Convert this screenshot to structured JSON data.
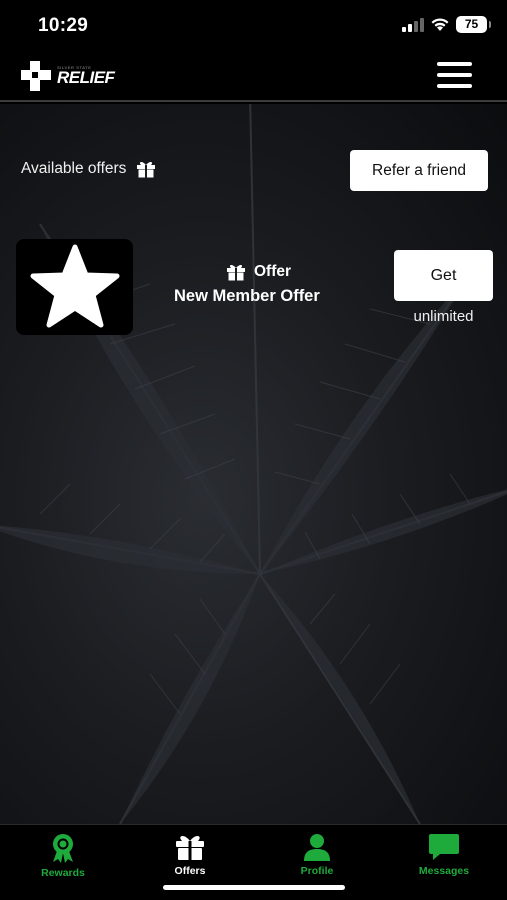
{
  "status_bar": {
    "time": "10:29",
    "battery": "75",
    "icons": [
      "signal-icon",
      "wifi-icon",
      "battery-icon"
    ]
  },
  "header": {
    "logo_tagline": "SILVER STATE",
    "logo_text": "RELIEF",
    "logo_icon": "cross-icon",
    "menu_icon": "hamburger-menu-icon"
  },
  "offers": {
    "available_label": "Available offers",
    "available_icon": "gift-icon",
    "refer_button_label": "Refer a friend",
    "items": [
      {
        "thumb_icon": "star-icon",
        "type_label": "Offer",
        "type_icon": "gift-icon",
        "title": "New Member Offer",
        "action_label": "Get",
        "limit": "unlimited"
      }
    ]
  },
  "tab_bar": {
    "tabs": [
      {
        "label": "Rewards",
        "icon": "rosette-icon",
        "active": false
      },
      {
        "label": "Offers",
        "icon": "gift-icon",
        "active": true
      },
      {
        "label": "Profile",
        "icon": "person-icon",
        "active": false
      },
      {
        "label": "Messages",
        "icon": "chat-bubble-icon",
        "active": false
      }
    ]
  },
  "colors": {
    "accent_green": "#1faa3c",
    "background": "#000000",
    "button_bg": "#ffffff"
  }
}
